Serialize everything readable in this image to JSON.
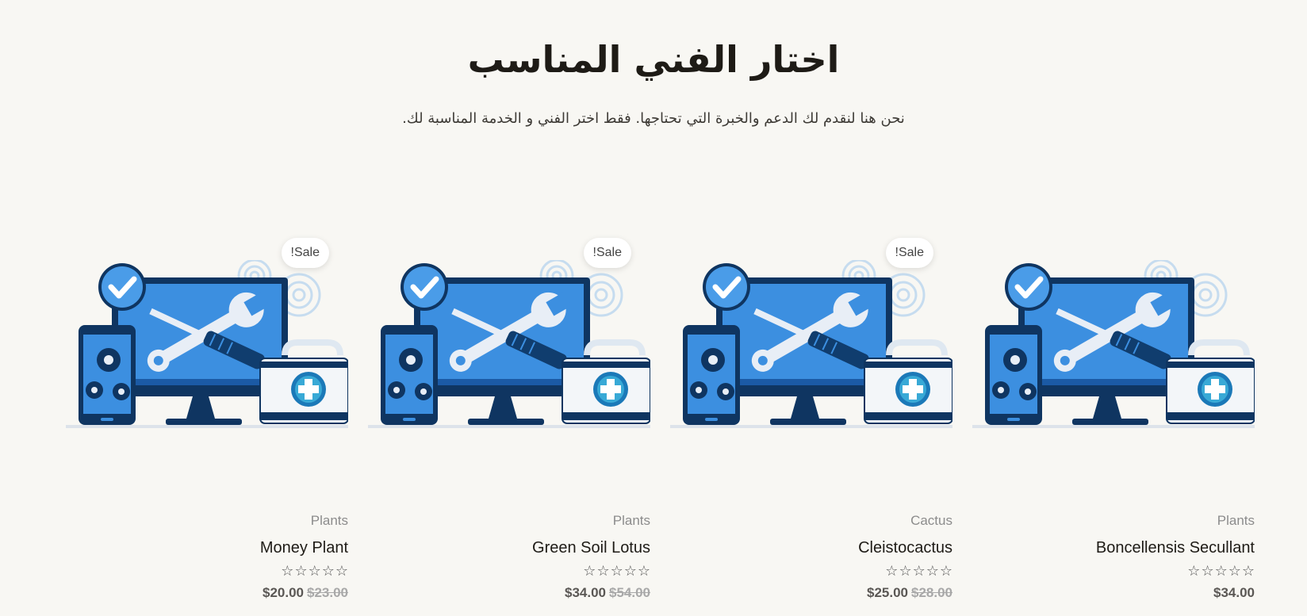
{
  "header": {
    "title": "اختار الفني المناسب",
    "subtitle": "نحن هنا لنقدم لك الدعم والخبرة التي تحتاجها. فقط اختر الفني و الخدمة المناسبة لك."
  },
  "colors": {
    "background": "#f8f7f3",
    "title": "#1e1b16",
    "icon_blue": "#3c8fe0",
    "icon_navy": "#0f3561",
    "price": "#5a5754",
    "old_price": "#a8a8a8"
  },
  "products": [
    {
      "category": "Plants",
      "name": "Money Plant",
      "sale_badge": "!Sale",
      "price": "$20.00",
      "old_price": "$23.00",
      "rating_stars": 0,
      "image_icon": "tech-support-illustration"
    },
    {
      "category": "Plants",
      "name": "Green Soil Lotus",
      "sale_badge": "!Sale",
      "price": "$34.00",
      "old_price": "$54.00",
      "rating_stars": 0,
      "image_icon": "tech-support-illustration"
    },
    {
      "category": "Cactus",
      "name": "Cleistocactus",
      "sale_badge": "!Sale",
      "price": "$25.00",
      "old_price": "$28.00",
      "rating_stars": 0,
      "image_icon": "tech-support-illustration"
    },
    {
      "category": "Plants",
      "name": "Boncellensis Secullant",
      "sale_badge": "",
      "price": "$34.00",
      "old_price": "",
      "rating_stars": 0,
      "image_icon": "tech-support-illustration"
    }
  ],
  "rating": {
    "max": 5,
    "empty_star": "☆"
  }
}
